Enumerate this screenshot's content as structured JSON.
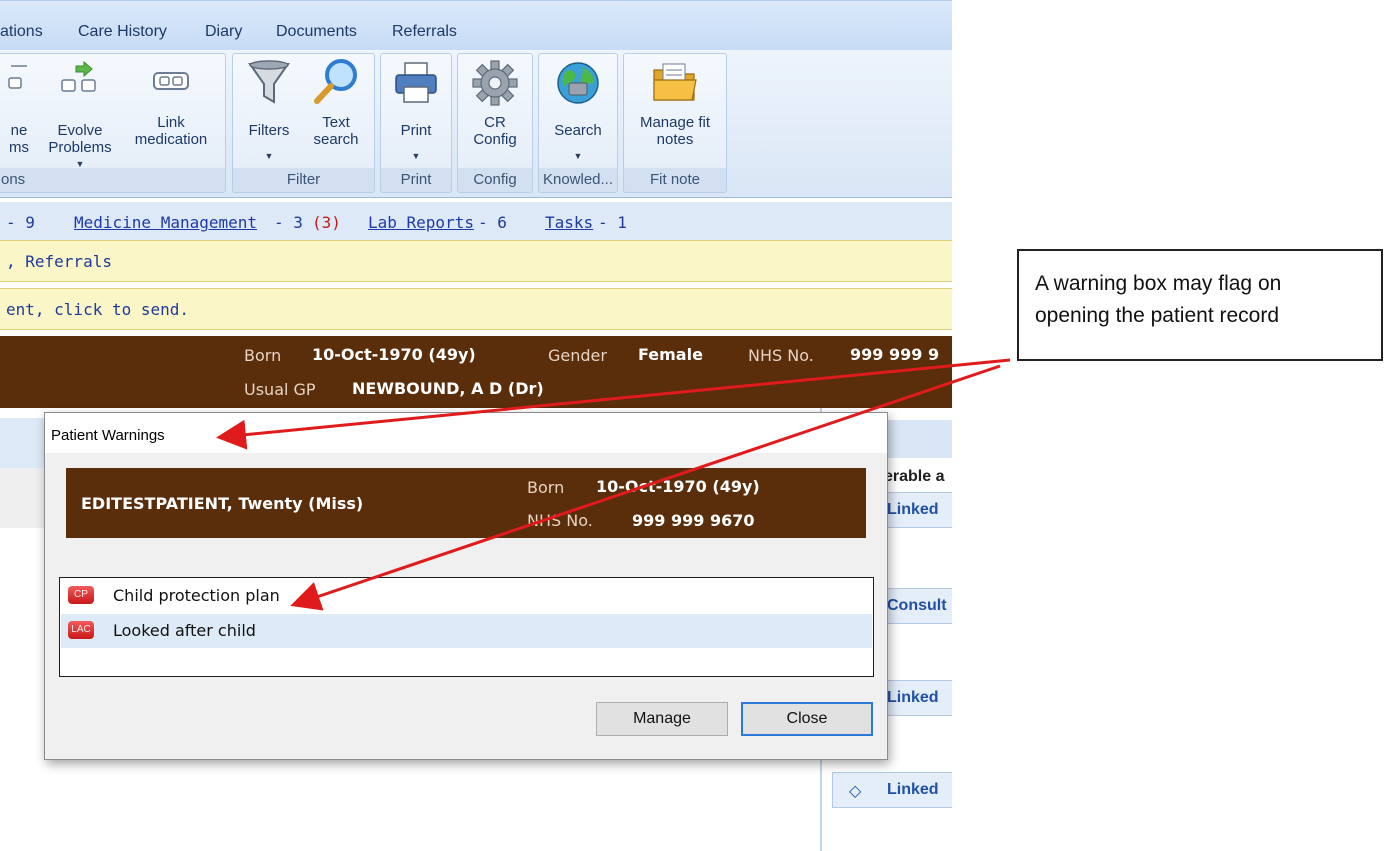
{
  "menu": {
    "tabs": [
      "ations",
      "Care History",
      "Diary",
      "Documents",
      "Referrals"
    ]
  },
  "ribbon": {
    "groups": {
      "g1_caption": "ons",
      "filter_caption": "Filter",
      "print_caption": "Print",
      "config_caption": "Config",
      "knowledge_caption": "Knowled...",
      "fitnote_caption": "Fit note"
    },
    "buttons": {
      "combine_l1": "ne",
      "combine_l2": "ms",
      "evolve_l1": "Evolve",
      "evolve_l2": "Problems",
      "link_l1": "Link",
      "link_l2": "medication",
      "filters": "Filters",
      "text_l1": "Text",
      "text_l2": "search",
      "print": "Print",
      "cr_l1": "CR",
      "cr_l2": "Config",
      "search": "Search",
      "fit_l1": "Manage fit",
      "fit_l2": "notes"
    }
  },
  "links": {
    "first_count": "- 9",
    "medicine": "Medicine Management",
    "medicine_count": "- 3",
    "medicine_alert": "(3)",
    "lab": "Lab Reports",
    "lab_count": "- 6",
    "tasks": "Tasks",
    "tasks_count": "- 1"
  },
  "notices": {
    "referrals": ", Referrals",
    "send": "ent, click to send."
  },
  "banner": {
    "born_label": "Born",
    "born_value": "10-Oct-1970 (49y)",
    "gender_label": "Gender",
    "gender_value": "Female",
    "nhs_label": "NHS No.",
    "nhs_value": "999 999 9",
    "gp_label": "Usual GP",
    "gp_value": "NEWBOUND, A D (Dr)"
  },
  "side": {
    "header_text": "erable a",
    "items": [
      "Linked",
      "Consult",
      "Linked",
      "Linked"
    ]
  },
  "dialog": {
    "title": "Patient Warnings",
    "patient_name": "EDITESTPATIENT,  Twenty (Miss)",
    "born_label": "Born",
    "born_value": "10-Oct-1970 (49y)",
    "nhs_label": "NHS No.",
    "nhs_value": "999 999 9670",
    "warnings": [
      {
        "badge": "CP",
        "text": "Child protection plan"
      },
      {
        "badge": "LAC",
        "text": "Looked after child"
      }
    ],
    "manage_label": "Manage",
    "close_label": "Close"
  },
  "annotation": {
    "line1": "A warning box may flag on",
    "line2": "opening the patient record"
  },
  "colors": {
    "banner_brown": "#5a2d0b",
    "arrow_red": "#e01b1b",
    "badge_red": "#d42020",
    "link_blue": "#1f3aa8"
  }
}
